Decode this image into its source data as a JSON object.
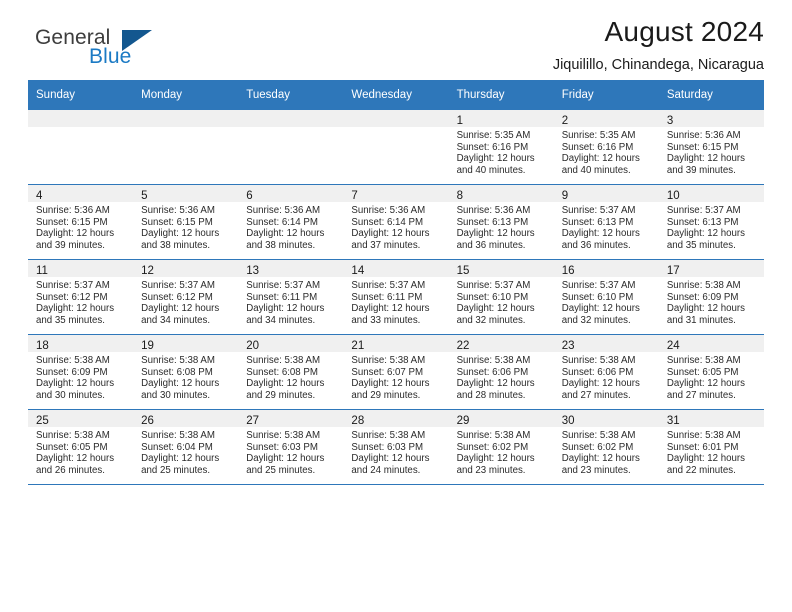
{
  "brand": {
    "name_part1": "General",
    "name_part2": "Blue",
    "accent_color": "#1b7ac4",
    "triangle_color": "#13578f"
  },
  "header": {
    "title": "August 2024",
    "subtitle": "Jiquilillo, Chinandega, Nicaragua"
  },
  "calendar": {
    "header_color": "#2e77ba",
    "weekday_headers": [
      "Sunday",
      "Monday",
      "Tuesday",
      "Wednesday",
      "Thursday",
      "Friday",
      "Saturday"
    ],
    "weeks": [
      [
        {
          "day": "",
          "lines": []
        },
        {
          "day": "",
          "lines": []
        },
        {
          "day": "",
          "lines": []
        },
        {
          "day": "",
          "lines": []
        },
        {
          "day": "1",
          "lines": [
            "Sunrise: 5:35 AM",
            "Sunset: 6:16 PM",
            "Daylight: 12 hours",
            "and 40 minutes."
          ]
        },
        {
          "day": "2",
          "lines": [
            "Sunrise: 5:35 AM",
            "Sunset: 6:16 PM",
            "Daylight: 12 hours",
            "and 40 minutes."
          ]
        },
        {
          "day": "3",
          "lines": [
            "Sunrise: 5:36 AM",
            "Sunset: 6:15 PM",
            "Daylight: 12 hours",
            "and 39 minutes."
          ]
        }
      ],
      [
        {
          "day": "4",
          "lines": [
            "Sunrise: 5:36 AM",
            "Sunset: 6:15 PM",
            "Daylight: 12 hours",
            "and 39 minutes."
          ]
        },
        {
          "day": "5",
          "lines": [
            "Sunrise: 5:36 AM",
            "Sunset: 6:15 PM",
            "Daylight: 12 hours",
            "and 38 minutes."
          ]
        },
        {
          "day": "6",
          "lines": [
            "Sunrise: 5:36 AM",
            "Sunset: 6:14 PM",
            "Daylight: 12 hours",
            "and 38 minutes."
          ]
        },
        {
          "day": "7",
          "lines": [
            "Sunrise: 5:36 AM",
            "Sunset: 6:14 PM",
            "Daylight: 12 hours",
            "and 37 minutes."
          ]
        },
        {
          "day": "8",
          "lines": [
            "Sunrise: 5:36 AM",
            "Sunset: 6:13 PM",
            "Daylight: 12 hours",
            "and 36 minutes."
          ]
        },
        {
          "day": "9",
          "lines": [
            "Sunrise: 5:37 AM",
            "Sunset: 6:13 PM",
            "Daylight: 12 hours",
            "and 36 minutes."
          ]
        },
        {
          "day": "10",
          "lines": [
            "Sunrise: 5:37 AM",
            "Sunset: 6:13 PM",
            "Daylight: 12 hours",
            "and 35 minutes."
          ]
        }
      ],
      [
        {
          "day": "11",
          "lines": [
            "Sunrise: 5:37 AM",
            "Sunset: 6:12 PM",
            "Daylight: 12 hours",
            "and 35 minutes."
          ]
        },
        {
          "day": "12",
          "lines": [
            "Sunrise: 5:37 AM",
            "Sunset: 6:12 PM",
            "Daylight: 12 hours",
            "and 34 minutes."
          ]
        },
        {
          "day": "13",
          "lines": [
            "Sunrise: 5:37 AM",
            "Sunset: 6:11 PM",
            "Daylight: 12 hours",
            "and 34 minutes."
          ]
        },
        {
          "day": "14",
          "lines": [
            "Sunrise: 5:37 AM",
            "Sunset: 6:11 PM",
            "Daylight: 12 hours",
            "and 33 minutes."
          ]
        },
        {
          "day": "15",
          "lines": [
            "Sunrise: 5:37 AM",
            "Sunset: 6:10 PM",
            "Daylight: 12 hours",
            "and 32 minutes."
          ]
        },
        {
          "day": "16",
          "lines": [
            "Sunrise: 5:37 AM",
            "Sunset: 6:10 PM",
            "Daylight: 12 hours",
            "and 32 minutes."
          ]
        },
        {
          "day": "17",
          "lines": [
            "Sunrise: 5:38 AM",
            "Sunset: 6:09 PM",
            "Daylight: 12 hours",
            "and 31 minutes."
          ]
        }
      ],
      [
        {
          "day": "18",
          "lines": [
            "Sunrise: 5:38 AM",
            "Sunset: 6:09 PM",
            "Daylight: 12 hours",
            "and 30 minutes."
          ]
        },
        {
          "day": "19",
          "lines": [
            "Sunrise: 5:38 AM",
            "Sunset: 6:08 PM",
            "Daylight: 12 hours",
            "and 30 minutes."
          ]
        },
        {
          "day": "20",
          "lines": [
            "Sunrise: 5:38 AM",
            "Sunset: 6:08 PM",
            "Daylight: 12 hours",
            "and 29 minutes."
          ]
        },
        {
          "day": "21",
          "lines": [
            "Sunrise: 5:38 AM",
            "Sunset: 6:07 PM",
            "Daylight: 12 hours",
            "and 29 minutes."
          ]
        },
        {
          "day": "22",
          "lines": [
            "Sunrise: 5:38 AM",
            "Sunset: 6:06 PM",
            "Daylight: 12 hours",
            "and 28 minutes."
          ]
        },
        {
          "day": "23",
          "lines": [
            "Sunrise: 5:38 AM",
            "Sunset: 6:06 PM",
            "Daylight: 12 hours",
            "and 27 minutes."
          ]
        },
        {
          "day": "24",
          "lines": [
            "Sunrise: 5:38 AM",
            "Sunset: 6:05 PM",
            "Daylight: 12 hours",
            "and 27 minutes."
          ]
        }
      ],
      [
        {
          "day": "25",
          "lines": [
            "Sunrise: 5:38 AM",
            "Sunset: 6:05 PM",
            "Daylight: 12 hours",
            "and 26 minutes."
          ]
        },
        {
          "day": "26",
          "lines": [
            "Sunrise: 5:38 AM",
            "Sunset: 6:04 PM",
            "Daylight: 12 hours",
            "and 25 minutes."
          ]
        },
        {
          "day": "27",
          "lines": [
            "Sunrise: 5:38 AM",
            "Sunset: 6:03 PM",
            "Daylight: 12 hours",
            "and 25 minutes."
          ]
        },
        {
          "day": "28",
          "lines": [
            "Sunrise: 5:38 AM",
            "Sunset: 6:03 PM",
            "Daylight: 12 hours",
            "and 24 minutes."
          ]
        },
        {
          "day": "29",
          "lines": [
            "Sunrise: 5:38 AM",
            "Sunset: 6:02 PM",
            "Daylight: 12 hours",
            "and 23 minutes."
          ]
        },
        {
          "day": "30",
          "lines": [
            "Sunrise: 5:38 AM",
            "Sunset: 6:02 PM",
            "Daylight: 12 hours",
            "and 23 minutes."
          ]
        },
        {
          "day": "31",
          "lines": [
            "Sunrise: 5:38 AM",
            "Sunset: 6:01 PM",
            "Daylight: 12 hours",
            "and 22 minutes."
          ]
        }
      ]
    ]
  }
}
